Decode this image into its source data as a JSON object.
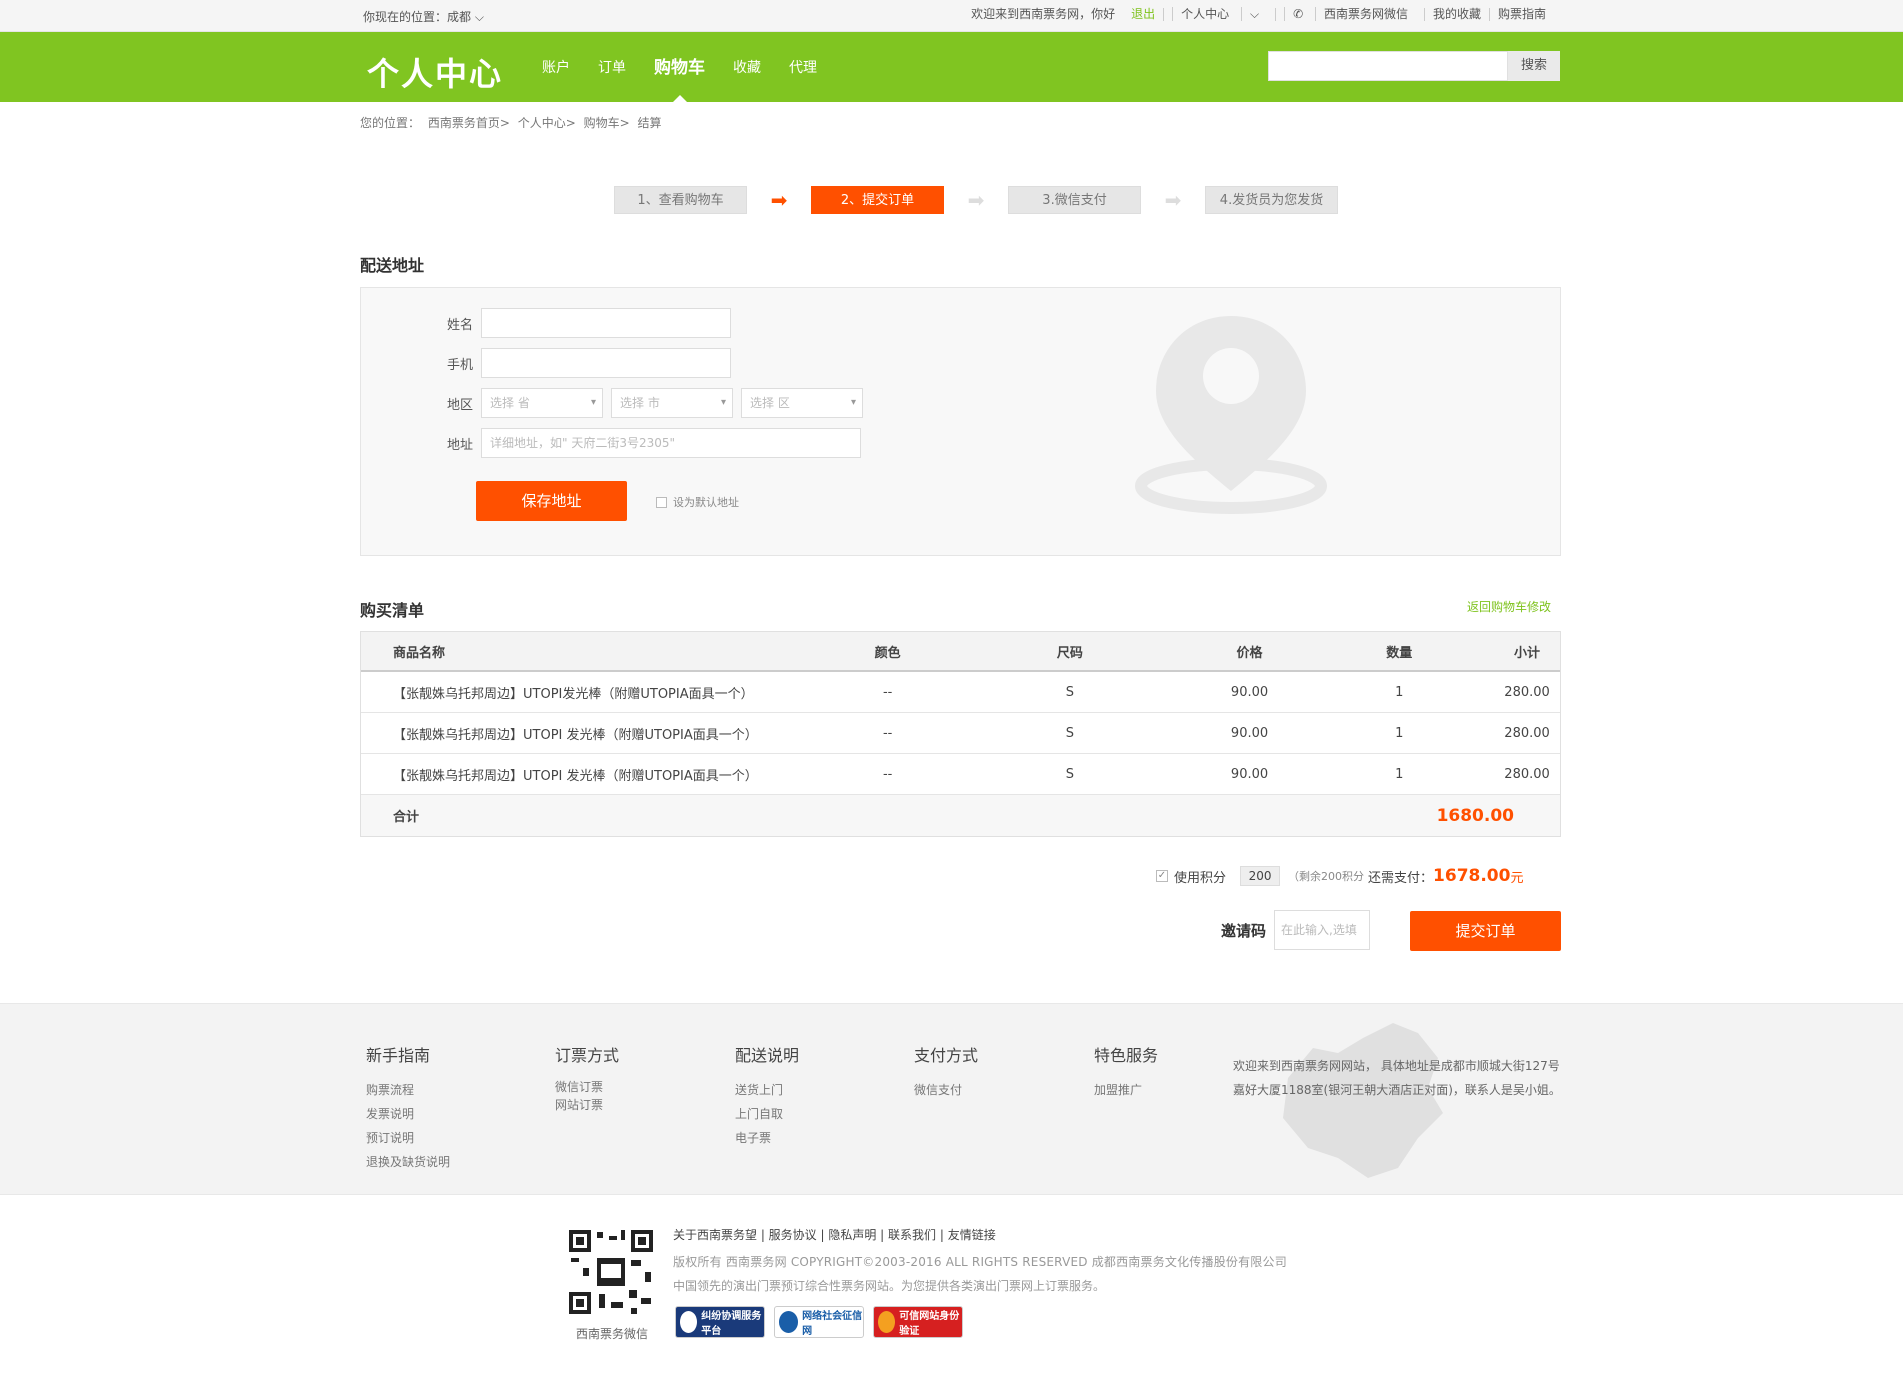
{
  "topbar": {
    "location_label": "你现在的位置：成都",
    "welcome": "欢迎来到西南票务网，你好",
    "logout": "退出",
    "personal_center": "个人中心",
    "wechat": "西南票务网微信",
    "favorites": "我的收藏",
    "guide": "购票指南"
  },
  "header": {
    "logo": "个人中心",
    "nav": [
      "账户",
      "订单",
      "购物车",
      "收藏",
      "代理"
    ],
    "active_nav": 2,
    "search_button": "搜索",
    "brand_color": "#80c521"
  },
  "breadcrumb": {
    "label": "您的位置：",
    "items": [
      "西南票务首页>",
      "个人中心>",
      "购物车>",
      "结算"
    ]
  },
  "steps": [
    "1、查看购物车",
    "2、提交订单",
    "3.微信支付",
    "4.发货员为您发货"
  ],
  "active_step": 1,
  "accent_color": "#ff5000",
  "address": {
    "title": "配送地址",
    "name_label": "姓名",
    "phone_label": "手机",
    "region_label": "地区",
    "province_placeholder": "选择 省",
    "city_placeholder": "选择 市",
    "district_placeholder": "选择 区",
    "addr_label": "地址",
    "addr_placeholder": "详细地址，如\" 天府二街3号2305\"",
    "save_button": "保存地址",
    "default_checkbox": "设为默认地址"
  },
  "order": {
    "title": "购买清单",
    "return_link": "返回购物车修改",
    "columns": [
      "商品名称",
      "颜色",
      "尺码",
      "价格",
      "数量",
      "小计"
    ],
    "rows": [
      [
        "【张靓姝乌托邦周边】UTOPI发光棒（附赠UTOPIA面具一个）",
        "--",
        "S",
        "90.00",
        "1",
        "280.00"
      ],
      [
        "【张靓姝乌托邦周边】UTOPI 发光棒（附赠UTOPIA面具一个）",
        "--",
        "S",
        "90.00",
        "1",
        "280.00"
      ],
      [
        "【张靓姝乌托邦周边】UTOPI 发光棒（附赠UTOPIA面具一个）",
        "--",
        "S",
        "90.00",
        "1",
        "280.00"
      ]
    ],
    "total_label": "合计",
    "total": "1680.00"
  },
  "points": {
    "use_label": "使用积分",
    "value": "200",
    "remaining": "（剩余200积分",
    "need_label": "还需支付：",
    "need_amount": "1678.00",
    "currency": "元"
  },
  "invite": {
    "label": "邀请码",
    "placeholder": "在此输入,选填",
    "submit": "提交订单"
  },
  "footer": {
    "cols": [
      {
        "title": "新手指南",
        "items": [
          "购票流程",
          "发票说明",
          "预订说明",
          "退换及缺货说明"
        ]
      },
      {
        "title": "订票方式",
        "items": [
          "微信订票",
          "网站订票"
        ]
      },
      {
        "title": "配送说明",
        "items": [
          "送货上门",
          "上门自取",
          "电子票"
        ]
      },
      {
        "title": "支付方式",
        "items": [
          "微信支付"
        ]
      },
      {
        "title": "特色服务",
        "items": [
          "加盟推广"
        ]
      }
    ],
    "address_text": "欢迎来到西南票务网网站，   具体地址是成都市顺城大街127号嘉好大厦1188室(银河王朝大酒店正对面)，联系人是吴小姐。",
    "qr_label": "西南票务微信",
    "links": "关于西南票务望 | 服务协议 | 隐私声明 | 联系我们 | 友情链接",
    "copyright": "版权所有 西南票务网 COPYRIGHT©2003-2016 ALL RIGHTS RESERVED 成都西南票务文化传播股份有限公司",
    "slogan": "中国领先的演出门票预订综合性票务网站。为您提供各类演出门票网上订票服务。",
    "badges": [
      "纠纷协调服务平台",
      "网络社会征信网",
      "可信网站身份验证"
    ]
  }
}
